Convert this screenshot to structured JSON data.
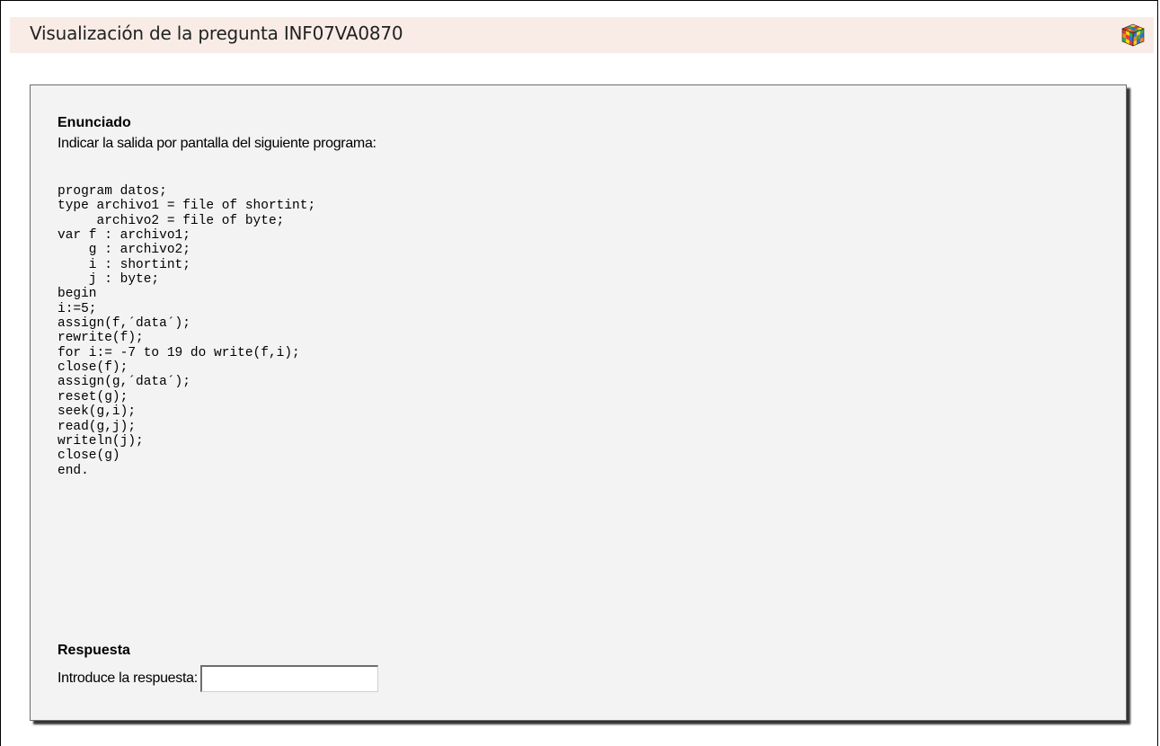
{
  "header": {
    "title": "Visualización de la pregunta INF07VA0870",
    "icon": "rubiks-cube-icon"
  },
  "question": {
    "enunciado_heading": "Enunciado",
    "prompt": "Indicar la salida por pantalla del siguiente programa:",
    "code": "program datos;\ntype archivo1 = file of shortint;\n     archivo2 = file of byte;\nvar f : archivo1;\n    g : archivo2;\n    i : shortint;\n    j : byte;\nbegin\ni:=5;\nassign(f,´data´);\nrewrite(f);\nfor i:= -7 to 19 do write(f,i);\nclose(f);\nassign(g,´data´);\nreset(g);\nseek(g,i);\nread(g,j);\nwriteln(j);\nclose(g)\nend."
  },
  "answer": {
    "heading": "Respuesta",
    "label": "Introduce la respuesta:",
    "value": "",
    "placeholder": ""
  },
  "colors": {
    "title_bar_bg": "#f9ece6",
    "box_bg": "#f3f3f3"
  }
}
